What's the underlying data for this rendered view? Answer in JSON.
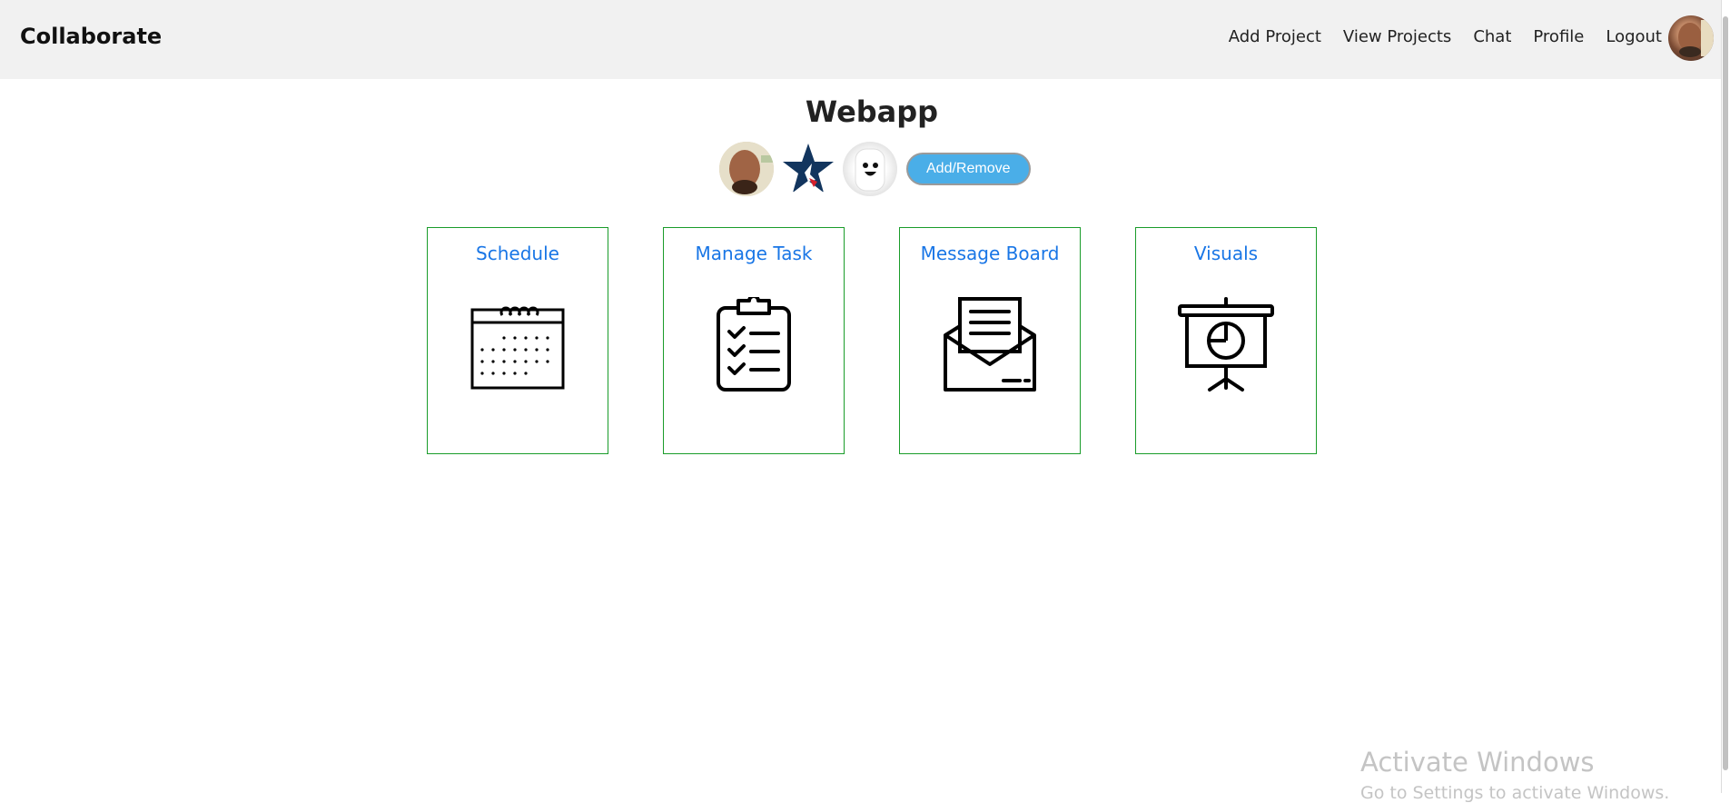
{
  "navbar": {
    "brand": "Collaborate",
    "links": [
      "Add Project",
      "View Projects",
      "Chat",
      "Profile",
      "Logout"
    ]
  },
  "project": {
    "title": "Webapp",
    "add_remove_label": "Add/Remove"
  },
  "cards": [
    {
      "title": "Schedule",
      "icon": "calendar-icon"
    },
    {
      "title": "Manage Task",
      "icon": "clipboard-checklist-icon"
    },
    {
      "title": "Message Board",
      "icon": "open-envelope-icon"
    },
    {
      "title": "Visuals",
      "icon": "presentation-board-icon"
    }
  ],
  "watermark": {
    "line1": "Activate Windows",
    "line2": "Go to Settings to activate Windows."
  },
  "colors": {
    "navbar_bg": "#f1f1f1",
    "card_border": "#1a9c2a",
    "card_title": "#1976e6",
    "button_bg": "#4aaee8"
  }
}
